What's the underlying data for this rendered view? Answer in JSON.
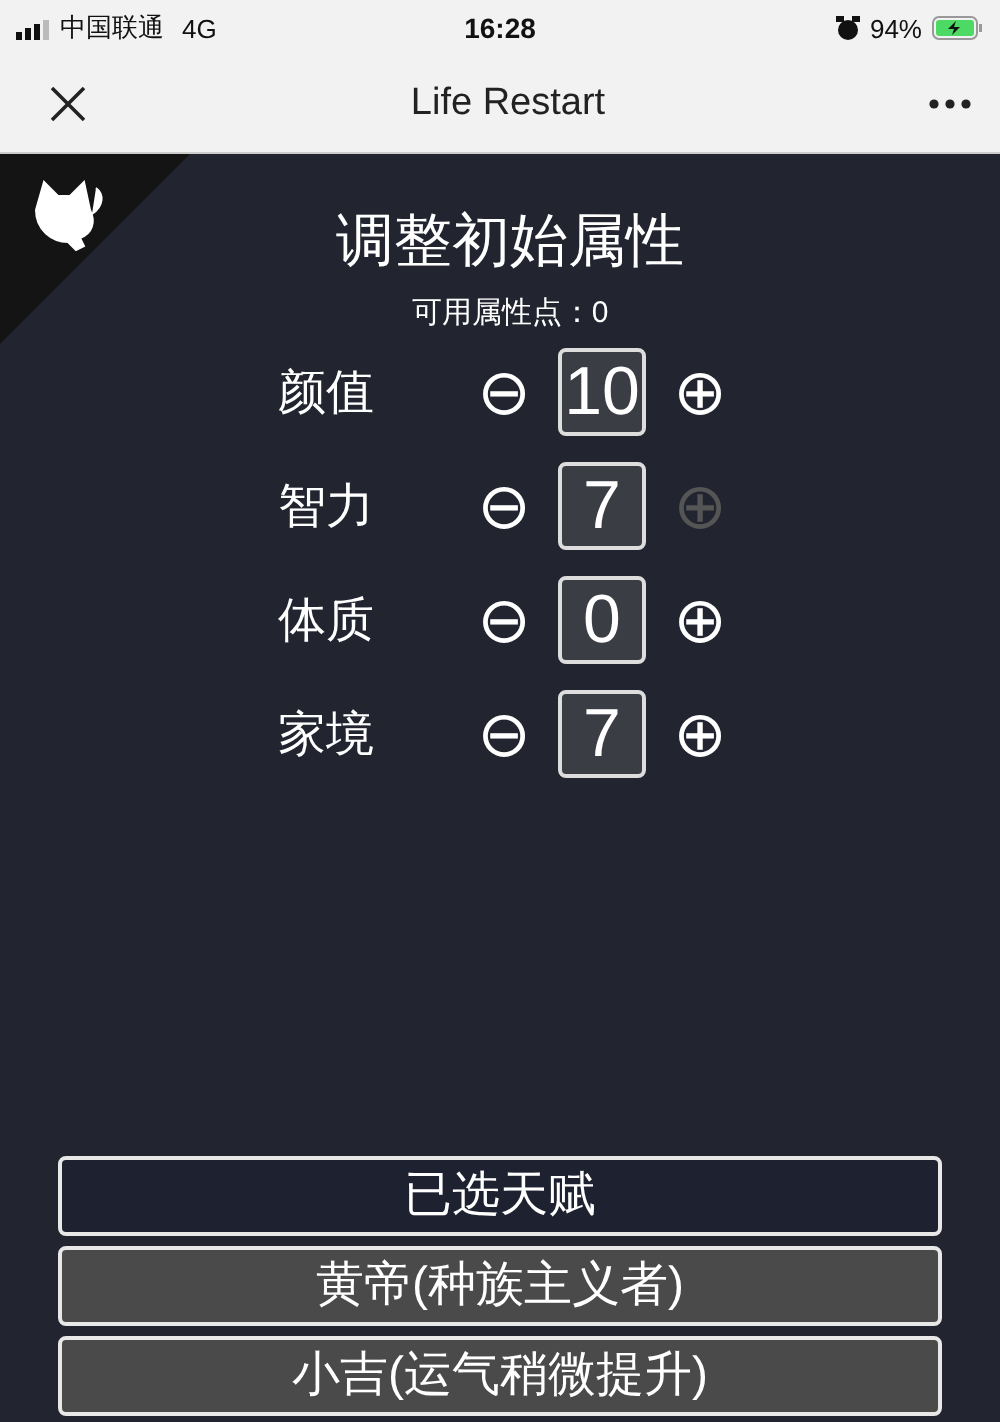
{
  "status_bar": {
    "carrier": "中国联通",
    "network": "4G",
    "time": "16:28",
    "battery": "94%"
  },
  "nav_bar": {
    "title": "Life Restart"
  },
  "panel": {
    "title": "调整初始属性",
    "points_label": "可用属性点：",
    "points": "0"
  },
  "attributes": [
    {
      "label": "颜值",
      "minus": "⊖",
      "value": "10",
      "plus": "⊕",
      "plus_disabled": false
    },
    {
      "label": "智力",
      "minus": "⊖",
      "value": "7",
      "plus": "⊕",
      "plus_disabled": true
    },
    {
      "label": "体质",
      "minus": "⊖",
      "value": "0",
      "plus": "⊕",
      "plus_disabled": false
    },
    {
      "label": "家境",
      "minus": "⊖",
      "value": "7",
      "plus": "⊕",
      "plus_disabled": false
    }
  ],
  "talents": [
    {
      "label": "已选天赋",
      "kind": "header"
    },
    {
      "label": "黄帝(种族主义者)",
      "kind": "talent"
    },
    {
      "label": "小吉(运气稍微提升)",
      "kind": "talent"
    }
  ]
}
